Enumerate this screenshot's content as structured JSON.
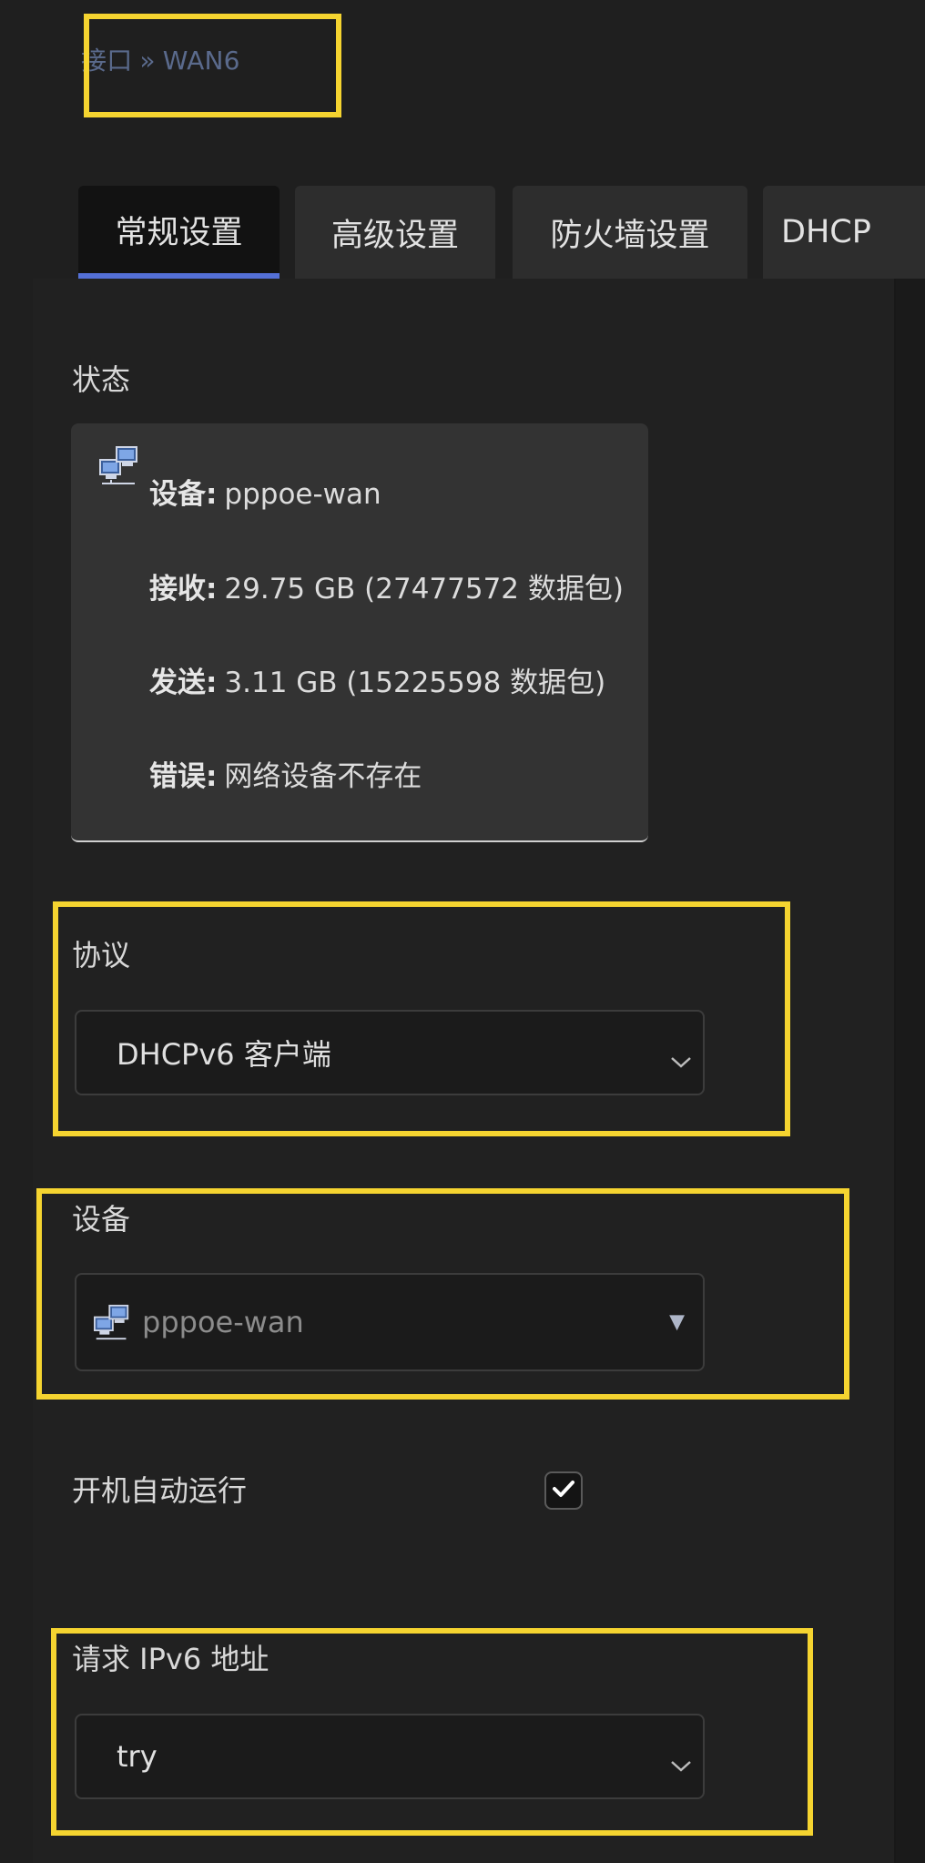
{
  "breadcrumb": {
    "parent": "接口",
    "separator": "»",
    "current": "WAN6"
  },
  "tabs": [
    {
      "label": "常规设置",
      "active": true
    },
    {
      "label": "高级设置",
      "active": false
    },
    {
      "label": "防火墙设置",
      "active": false
    },
    {
      "label": "DHCP",
      "active": false
    }
  ],
  "status": {
    "label": "状态",
    "icon": "network-device-icon",
    "lines": [
      {
        "key": "设备:",
        "value": "pppoe-wan"
      },
      {
        "key": "接收:",
        "value": "29.75 GB (27477572 数据包)"
      },
      {
        "key": "发送:",
        "value": "3.11 GB (15225598 数据包)"
      },
      {
        "key": "错误:",
        "value": "网络设备不存在"
      }
    ]
  },
  "protocol": {
    "label": "协议",
    "value": "DHCPv6 客户端"
  },
  "device": {
    "label": "设备",
    "value": "pppoe-wan",
    "icon": "network-device-icon"
  },
  "autostart": {
    "label": "开机自动运行",
    "checked": true
  },
  "request_ipv6": {
    "label": "请求 IPv6 地址",
    "value": "try"
  },
  "colors": {
    "background": "#1f1f1f",
    "tab_active_underline": "#5470d6",
    "highlight": "#f5d430",
    "breadcrumb": "#5a6a8c"
  }
}
